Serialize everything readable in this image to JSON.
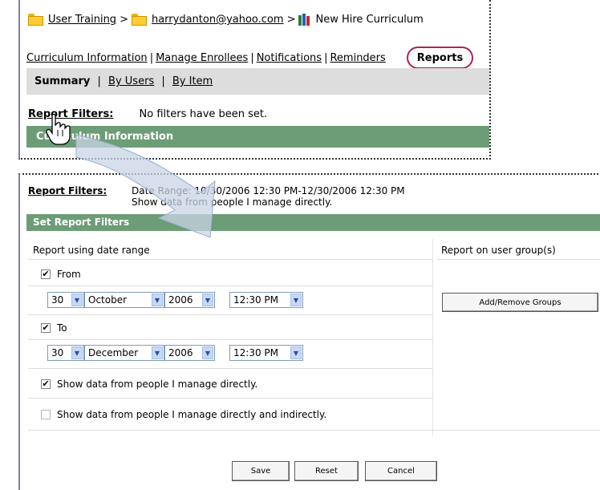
{
  "breadcrumb": {
    "items": [
      "User Training",
      "harrydanton@yahoo.com",
      "New Hire Curriculum"
    ],
    "separator": ">"
  },
  "nav": {
    "links": [
      "Curriculum Information",
      "Manage Enrollees",
      "Notifications",
      "Reminders"
    ],
    "separator": "|",
    "active": "Reports"
  },
  "subtabs": {
    "active": "Summary",
    "links": [
      "By Users",
      "By Item"
    ],
    "separator": "|"
  },
  "top_filters": {
    "label": "Report Filters:",
    "value": "No filters have been set."
  },
  "top_section": {
    "title": "Curriculum Information"
  },
  "bottom_filters": {
    "label": "Report Filters:",
    "line1": "Date Range: 10/30/2006 12:30 PM-12/30/2006 12:30 PM",
    "line2": "Show data from people I manage directly."
  },
  "set_filters": {
    "title": "Set Report Filters",
    "left_header": "Report using date range",
    "right_header": "Report on user group(s)",
    "from_label": "From",
    "from_checked": true,
    "from": {
      "day": "30",
      "month": "October",
      "year": "2006",
      "time": "12:30 PM"
    },
    "to_label": "To",
    "to_checked": true,
    "to": {
      "day": "30",
      "month": "December",
      "year": "2006",
      "time": "12:30 PM"
    },
    "direct_label": "Show data from people I manage directly.",
    "direct_checked": true,
    "indirect_label": "Show data from people I manage directly and indirectly.",
    "indirect_checked": false,
    "groups_button": "Add/Remove Groups"
  },
  "buttons": {
    "save": "Save",
    "reset": "Reset",
    "cancel": "Cancel"
  },
  "colors": {
    "section_green": "#6c9d76",
    "reports_highlight": "#b0215f",
    "tab_bar": "#dddddd"
  }
}
